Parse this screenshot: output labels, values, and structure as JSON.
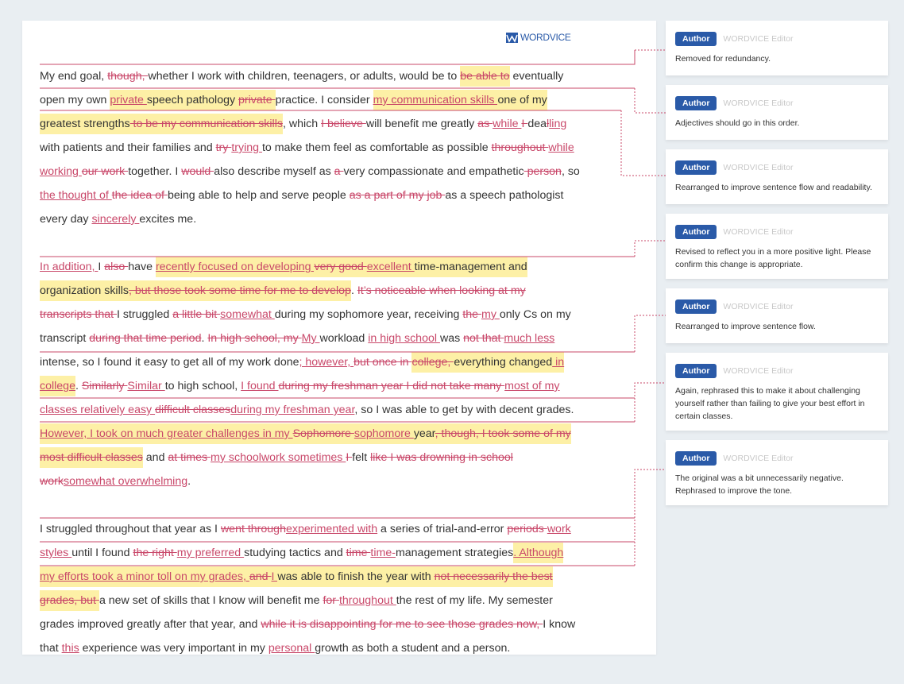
{
  "logo": {
    "text": "WORDVICE",
    "icon": "wordvice-logo-icon"
  },
  "colors": {
    "insert": "#c9486a",
    "delete": "#c9486a",
    "highlight": "#fdf0a6",
    "author_badge": "#2a5aa8",
    "background": "#e9eef2"
  },
  "paragraphs": [
    [
      {
        "t": "n",
        "v": "My end goal, "
      },
      {
        "t": "d",
        "v": "though, "
      },
      {
        "t": "n",
        "v": "whether I work with children, teenagers, or adults, would be to "
      },
      {
        "t": "d",
        "v": "be able to",
        "h": true
      },
      {
        "t": "n",
        "v": " eventually open my own "
      },
      {
        "t": "i",
        "v": "private ",
        "h": true
      },
      {
        "t": "n",
        "v": "speech pathology ",
        "h": true
      },
      {
        "t": "d",
        "v": "private ",
        "h": true
      },
      {
        "t": "n",
        "v": "practice. I consider "
      },
      {
        "t": "i",
        "v": "my communication skills ",
        "h": true
      },
      {
        "t": "n",
        "v": "one of my greatest strengths",
        "h": true
      },
      {
        "t": "d",
        "v": " to be my communication skills",
        "h": true
      },
      {
        "t": "n",
        "v": ", which "
      },
      {
        "t": "d",
        "v": "I believe "
      },
      {
        "t": "n",
        "v": "will benefit me greatly "
      },
      {
        "t": "d",
        "v": "as "
      },
      {
        "t": "i",
        "v": "while "
      },
      {
        "t": "d",
        "v": "I "
      },
      {
        "t": "n",
        "v": "dea"
      },
      {
        "t": "d",
        "v": "l"
      },
      {
        "t": "i",
        "v": "ling"
      },
      {
        "t": "n",
        "v": " with patients and their families and "
      },
      {
        "t": "d",
        "v": "try "
      },
      {
        "t": "i",
        "v": "trying "
      },
      {
        "t": "n",
        "v": "to make them feel as comfortable as possible "
      },
      {
        "t": "d",
        "v": "throughout "
      },
      {
        "t": "i",
        "v": "while working "
      },
      {
        "t": "d",
        "v": "our work "
      },
      {
        "t": "n",
        "v": "together. I "
      },
      {
        "t": "d",
        "v": "would "
      },
      {
        "t": "n",
        "v": "also describe myself as "
      },
      {
        "t": "d",
        "v": "a "
      },
      {
        "t": "n",
        "v": "very compassionate and empathetic"
      },
      {
        "t": "d",
        "v": " person"
      },
      {
        "t": "n",
        "v": ", so "
      },
      {
        "t": "i",
        "v": "the thought of "
      },
      {
        "t": "d",
        "v": "the idea of "
      },
      {
        "t": "n",
        "v": "being able to help and serve people "
      },
      {
        "t": "d",
        "v": "as a part of my job "
      },
      {
        "t": "n",
        "v": "as a speech pathologist every day "
      },
      {
        "t": "i",
        "v": "sincerely "
      },
      {
        "t": "n",
        "v": "excites me."
      }
    ],
    [
      {
        "t": "i",
        "v": "In addition, "
      },
      {
        "t": "n",
        "v": "I "
      },
      {
        "t": "d",
        "v": "also "
      },
      {
        "t": "n",
        "v": "have "
      },
      {
        "t": "i",
        "v": "recently focused on developing ",
        "h": true
      },
      {
        "t": "d",
        "v": "very good ",
        "h": true
      },
      {
        "t": "i",
        "v": "excellent ",
        "h": true
      },
      {
        "t": "n",
        "v": "time-management and organization skills",
        "h": true
      },
      {
        "t": "d",
        "v": ", but those took some time for me to develop",
        "h": true
      },
      {
        "t": "n",
        "v": ". "
      },
      {
        "t": "d",
        "v": "It’s noticeable when looking at my transcripts that "
      },
      {
        "t": "n",
        "v": "I struggled "
      },
      {
        "t": "d",
        "v": "a little bit "
      },
      {
        "t": "i",
        "v": "somewhat "
      },
      {
        "t": "n",
        "v": "during my sophomore year, receiving "
      },
      {
        "t": "d",
        "v": "the "
      },
      {
        "t": "i",
        "v": "my "
      },
      {
        "t": "n",
        "v": "only Cs on my transcript "
      },
      {
        "t": "d",
        "v": "during that time period"
      },
      {
        "t": "n",
        "v": ". "
      },
      {
        "t": "d",
        "v": "In high school, my "
      },
      {
        "t": "i",
        "v": "My "
      },
      {
        "t": "n",
        "v": "workload "
      },
      {
        "t": "i",
        "v": "in high school "
      },
      {
        "t": "n",
        "v": "was "
      },
      {
        "t": "d",
        "v": "not that "
      },
      {
        "t": "i",
        "v": "much less "
      },
      {
        "t": "n",
        "v": "intense, so I found it easy to get all of my work done"
      },
      {
        "t": "i",
        "v": "; however,  "
      },
      {
        "t": "d",
        "v": "but once in "
      },
      {
        "t": "d",
        "v": "college, ",
        "h": true
      },
      {
        "t": "n",
        "v": "everything changed",
        "h": true
      },
      {
        "t": "i",
        "v": " in college",
        "h": true
      },
      {
        "t": "n",
        "v": ". "
      },
      {
        "t": "d",
        "v": "Similarly "
      },
      {
        "t": "i",
        "v": "Similar "
      },
      {
        "t": "n",
        "v": "to high school, "
      },
      {
        "t": "i",
        "v": "I found "
      },
      {
        "t": "d",
        "v": "during my freshman year I did not take many "
      },
      {
        "t": "i",
        "v": "most of my classes relatively easy "
      },
      {
        "t": "d",
        "v": "difficult classes"
      },
      {
        "t": "i",
        "v": "during my freshman year"
      },
      {
        "t": "n",
        "v": ", so I was able to get by with decent grades. "
      },
      {
        "t": "i",
        "v": "However, I took on much greater challenges in my ",
        "h": true
      },
      {
        "t": "d",
        "v": "Sophomore ",
        "h": true
      },
      {
        "t": "i",
        "v": "sophomore ",
        "h": true
      },
      {
        "t": "n",
        "v": "year",
        "h": true
      },
      {
        "t": "d",
        "v": ", though,  I took some of my most difficult classes",
        "h": true
      },
      {
        "t": "n",
        "v": " and "
      },
      {
        "t": "d",
        "v": "at times "
      },
      {
        "t": "i",
        "v": "my schoolwork sometimes "
      },
      {
        "t": "d",
        "v": "I "
      },
      {
        "t": "n",
        "v": "felt "
      },
      {
        "t": "d",
        "v": "like I was drowning in school work"
      },
      {
        "t": "i",
        "v": "somewhat overwhelming"
      },
      {
        "t": "n",
        "v": "."
      }
    ],
    [
      {
        "t": "n",
        "v": "I struggled throughout that year as I "
      },
      {
        "t": "d",
        "v": "went through"
      },
      {
        "t": "i",
        "v": "experimented with"
      },
      {
        "t": "n",
        "v": " a series of trial-and-error "
      },
      {
        "t": "d",
        "v": "periods "
      },
      {
        "t": "i",
        "v": "work styles "
      },
      {
        "t": "n",
        "v": "until I found "
      },
      {
        "t": "d",
        "v": "the right "
      },
      {
        "t": "i",
        "v": "my preferred "
      },
      {
        "t": "n",
        "v": "studying tactics and "
      },
      {
        "t": "d",
        "v": "time "
      },
      {
        "t": "i",
        "v": "time-"
      },
      {
        "t": "n",
        "v": "management strategies"
      },
      {
        "t": "i",
        "v": ". Although my efforts took a minor toll on my grades, ",
        "h": true
      },
      {
        "t": "d",
        "v": "and ",
        "h": true
      },
      {
        "t": "i",
        "v": "I ",
        "h": true
      },
      {
        "t": "n",
        "v": "was able to finish the year with ",
        "h": true
      },
      {
        "t": "d",
        "v": "not necessarily the best grades, but ",
        "h": true
      },
      {
        "t": "n",
        "v": "a new set of skills that I know will benefit me "
      },
      {
        "t": "d",
        "v": "for "
      },
      {
        "t": "i",
        "v": "throughout "
      },
      {
        "t": "n",
        "v": "the rest of my life. My semester grades improved greatly after that year, and "
      },
      {
        "t": "d",
        "v": "while it is disappointing for me to see those grades now, "
      },
      {
        "t": "n",
        "v": "I know that "
      },
      {
        "t": "i",
        "v": "this"
      },
      {
        "t": "n",
        "v": " experience was very important in my "
      },
      {
        "t": "i",
        "v": "personal "
      },
      {
        "t": "n",
        "v": "growth as both a student and a person."
      }
    ]
  ],
  "comments": [
    {
      "badge": "Author",
      "editor": "WORDVICE Editor",
      "text": "Removed for redundancy."
    },
    {
      "badge": "Author",
      "editor": "WORDVICE Editor",
      "text": "Adjectives should go in this order."
    },
    {
      "badge": "Author",
      "editor": "WORDVICE Editor",
      "text": "Rearranged to improve sentence flow and readability."
    },
    {
      "badge": "Author",
      "editor": "WORDVICE Editor",
      "text": "Revised to reflect you in a more positive light. Please confirm this change is appropriate."
    },
    {
      "badge": "Author",
      "editor": "WORDVICE Editor",
      "text": "Rearranged to improve sentence flow."
    },
    {
      "badge": "Author",
      "editor": "WORDVICE Editor",
      "text": "Again, rephrased this to make it about challenging yourself rather than failing to give your best effort in certain classes."
    },
    {
      "badge": "Author",
      "editor": "WORDVICE Editor",
      "text": "The original was a bit unnecessarily negative. Rephrased to improve the tone."
    }
  ]
}
